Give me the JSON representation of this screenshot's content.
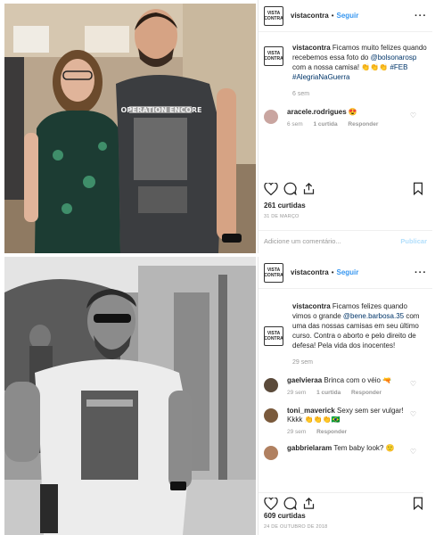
{
  "post1": {
    "username": "vistacontra",
    "follow": "Seguir",
    "logo_text": "VISTA CONTRA",
    "caption": {
      "user": "vistacontra",
      "text1": " Ficamos muito felizes quando recebemos essa foto do ",
      "mention": "@bolsonarosp",
      "text2": " com a nossa camisa! 👏👏👏 ",
      "hashtags": "#FEB #AlegriaNaGuerra",
      "time": "6 sem"
    },
    "comments": [
      {
        "user": "aracele.rodrigues",
        "text": " 😍",
        "time": "6 sem",
        "likes": "1 curtida",
        "reply": "Responder"
      }
    ],
    "likes": "261 curtidas",
    "date": "31 DE MARÇO",
    "add_comment_placeholder": "Adicione um comentário...",
    "publish": "Publicar",
    "shirt_text": "OPERATION ENCORE"
  },
  "post2": {
    "username": "vistacontra",
    "follow": "Seguir",
    "logo_text": "VISTA CONTRA",
    "caption": {
      "user": "vistacontra",
      "text1": " Ficamos felizes quando vimos o grande ",
      "mention": "@bene.barbosa.35",
      "text2": " com uma das nossas camisas em seu último curso. Contra o aborto e pelo direito de defesa! Pela vida dos inocentes!",
      "time": "29 sem"
    },
    "comments": [
      {
        "user": "gaelvieraa",
        "text": " Brinca com o véio 🔫",
        "time": "29 sem",
        "likes": "1 curtida",
        "reply": "Responder"
      },
      {
        "user": "toni_maverick",
        "text": " Sexy sem ser vulgar! Kkkk 👏👏👏🇧🇷",
        "time": "29 sem",
        "likes": "",
        "reply": "Responder"
      },
      {
        "user": "gabbrielaram",
        "text": " Tem baby look? 🙂",
        "time": "",
        "likes": "",
        "reply": ""
      }
    ],
    "likes": "609 curtidas",
    "date": "24 DE OUTUBRO DE 2018"
  }
}
